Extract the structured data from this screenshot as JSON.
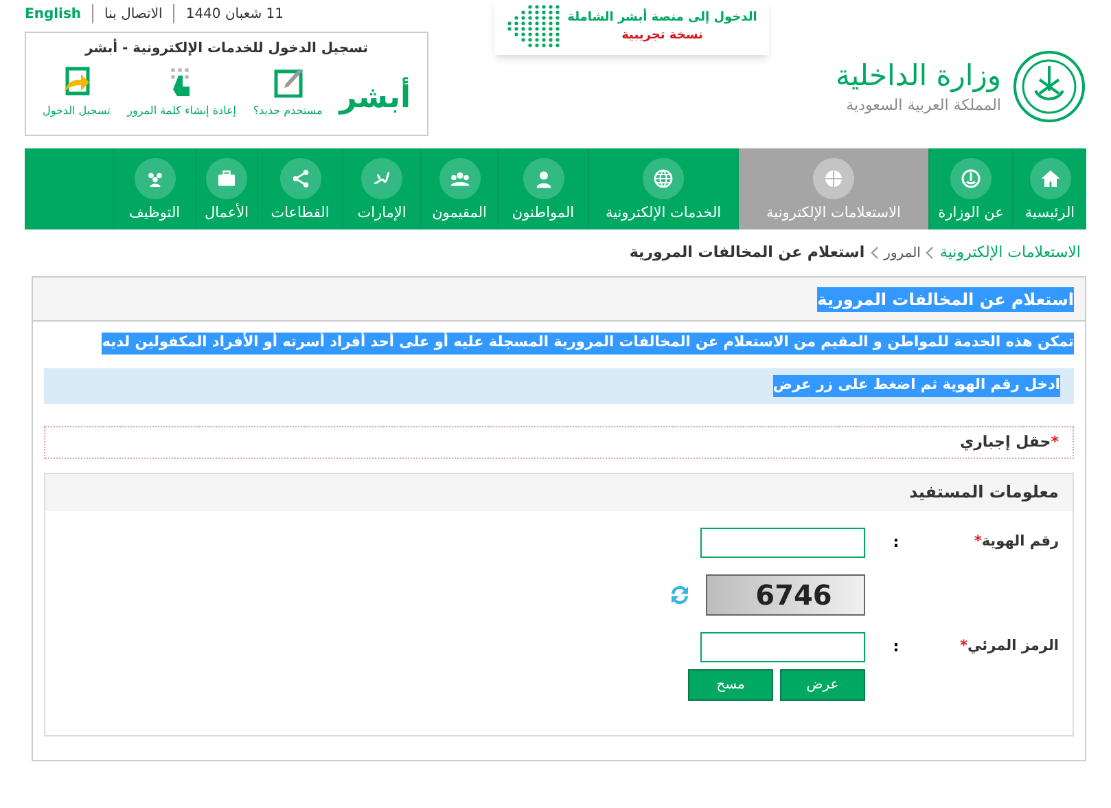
{
  "top_links": [
    {
      "label": "11 شعبان 1440",
      "kind": "date"
    },
    {
      "label": "الاتصال بنا",
      "kind": "link"
    },
    {
      "label": "English",
      "kind": "language"
    }
  ],
  "absher_box": {
    "title": "تسجيل الدخول للخدمات الإلكترونية - أبشر",
    "logo": "أبشر",
    "actions": [
      {
        "label": "مستخدم جديد؟"
      },
      {
        "label": "إعادة إنشاء كلمة المرور"
      },
      {
        "label": "تسجيل الدخول"
      }
    ]
  },
  "banner": {
    "line_1": "الدخول إلى منصة أبشر الشاملة",
    "line_2": "نسخة تجريبية"
  },
  "ministry": {
    "name": "وزارة الداخلية",
    "country": "المملكة العربية السعودية"
  },
  "nav": [
    {
      "label": "الرئيسية",
      "selected": false
    },
    {
      "label": "عن الوزارة",
      "selected": false
    },
    {
      "label": "الاستعلامات الإلكترونية",
      "selected": true
    },
    {
      "label": "الخدمات الإلكترونية",
      "selected": false
    },
    {
      "label": "المواطنون",
      "selected": false
    },
    {
      "label": "المقيمون",
      "selected": false
    },
    {
      "label": "الإمارات",
      "selected": false
    },
    {
      "label": "القطاعات",
      "selected": false
    },
    {
      "label": "الأعمال",
      "selected": false
    },
    {
      "label": "التوظيف",
      "selected": false
    }
  ],
  "breadcrumb": [
    {
      "label": "الاستعلامات الإلكترونية",
      "kind": "link"
    },
    {
      "label": "المرور",
      "kind": "link"
    },
    {
      "label": "استعلام عن المخالفات المرورية",
      "kind": "current"
    }
  ],
  "panel": {
    "title": "استعلام عن المخالفات المرورية",
    "title_highlighted": true,
    "description": "تمكن هذه الخدمة للمواطن و المقيم من الاستعلام عن المخالفات المرورية المسجلة عليه أو على أحد أفراد أسرته أو الأفراد المكفولين لديه",
    "description_highlighted": true,
    "hint": "ادخل رقم الهوية ثم اضغط على زر عرض",
    "hint_highlighted": true,
    "required_note": {
      "mark": "*",
      "text": "حقل إجباري"
    },
    "section": {
      "title": "معلومات المستفيد",
      "fields": [
        {
          "kind": "input",
          "label": "رقم الهوية",
          "required_mark": "*",
          "separator": ":"
        },
        {
          "kind": "captcha",
          "code": "6746"
        },
        {
          "kind": "input",
          "label": "الرمز المرئي",
          "required_mark": "*",
          "separator": ":"
        }
      ],
      "buttons": [
        "عرض",
        "مسح"
      ]
    }
  }
}
